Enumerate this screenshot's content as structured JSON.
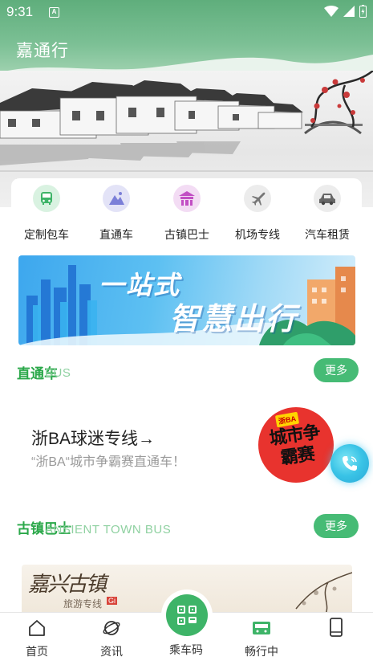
{
  "status_bar": {
    "time": "9:31",
    "notification_icon": "A"
  },
  "header": {
    "title": "嘉通行",
    "color": "#6bb585"
  },
  "categories": [
    {
      "label": "定制包车",
      "icon": "bus-icon",
      "color": "#3eb468"
    },
    {
      "label": "直通车",
      "icon": "mountain-icon",
      "color": "#7b7fd8"
    },
    {
      "label": "古镇巴士",
      "icon": "temple-icon",
      "color": "#c24fc4"
    },
    {
      "label": "机场专线",
      "icon": "airplane-icon",
      "color": "#777777"
    },
    {
      "label": "汽车租赁",
      "icon": "car-icon",
      "color": "#666666"
    }
  ],
  "banner": {
    "line1": "一站式",
    "line2": "智慧出行"
  },
  "direct_section": {
    "title": "直通车",
    "subtitle": "BUS",
    "more_label": "更多"
  },
  "promo": {
    "title": "浙BA球迷专线→",
    "subtitle": "“浙BA“城市争霸赛直通车！",
    "badge_text": "城市争霸赛",
    "badge_top": "浙BA"
  },
  "town_section": {
    "title": "古镇巴士",
    "subtitle": "ANSIENT TOWN BUS",
    "more_label": "更多"
  },
  "town_card": {
    "title": "嘉兴古镇",
    "subtitle": "旅游专线",
    "tag": "Gi"
  },
  "bottom_nav": {
    "items": [
      {
        "label": "首页",
        "icon": "home-icon"
      },
      {
        "label": "资讯",
        "icon": "planet-icon"
      },
      {
        "label": "乘车码",
        "icon": "qr-bus-icon"
      },
      {
        "label": "畅行中",
        "icon": "ticket-icon"
      },
      {
        "label": "",
        "icon": "phone-device-icon"
      }
    ]
  },
  "accent_color": "#46bb75"
}
